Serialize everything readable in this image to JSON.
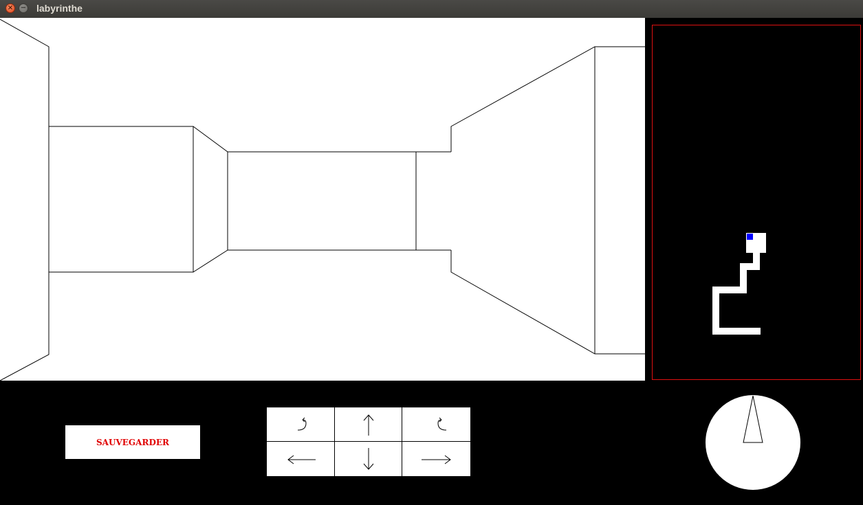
{
  "window": {
    "title": "labyrinthe",
    "close_glyph": "×",
    "minimize_glyph": "−"
  },
  "controls": {
    "save_label": "SAUVEGARDER",
    "pad": [
      {
        "name": "turn-left-button",
        "icon": "turn-left-icon"
      },
      {
        "name": "forward-button",
        "icon": "arrow-up-icon"
      },
      {
        "name": "turn-right-button",
        "icon": "turn-right-icon"
      },
      {
        "name": "strafe-left-button",
        "icon": "arrow-left-icon"
      },
      {
        "name": "backward-button",
        "icon": "arrow-down-icon"
      },
      {
        "name": "strafe-right-button",
        "icon": "arrow-right-icon"
      }
    ]
  },
  "colors": {
    "background": "#000000",
    "wall": "#ffffff",
    "minimap_border": "#e01010",
    "save_text": "#e00000",
    "player_marker": "#0000ff"
  },
  "icons": [
    "close-icon",
    "minimize-icon",
    "compass-needle-icon"
  ]
}
